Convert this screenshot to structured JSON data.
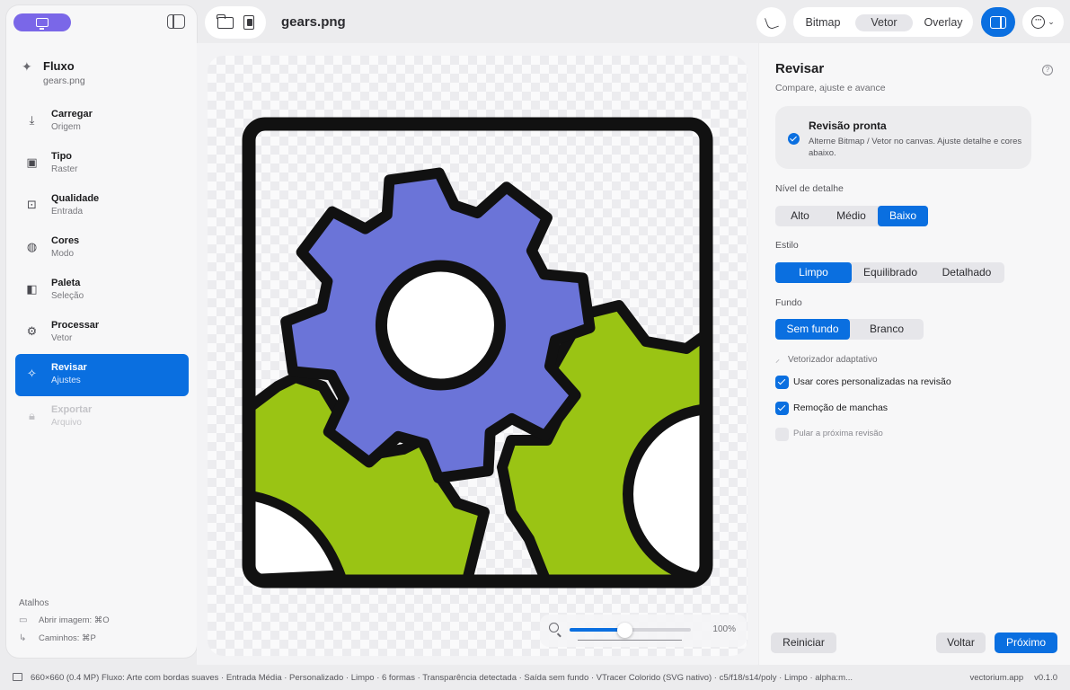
{
  "header": {
    "file_name": "gears.png"
  },
  "view_modes": {
    "options": [
      "Bitmap",
      "Vetor",
      "Overlay"
    ],
    "selected": "Vetor"
  },
  "sidebar": {
    "flow_title": "Fluxo",
    "flow_file": "gears.png",
    "steps": [
      {
        "name": "Carregar",
        "sub": "Origem",
        "icon": "download-icon",
        "state": "done"
      },
      {
        "name": "Tipo",
        "sub": "Raster",
        "icon": "images-icon",
        "state": "done"
      },
      {
        "name": "Qualidade",
        "sub": "Entrada",
        "icon": "quality-icon",
        "state": "done"
      },
      {
        "name": "Cores",
        "sub": "Modo",
        "icon": "palette-icon",
        "state": "done"
      },
      {
        "name": "Paleta",
        "sub": "Seleção",
        "icon": "swatches-icon",
        "state": "done"
      },
      {
        "name": "Processar",
        "sub": "Vetor",
        "icon": "gears-icon",
        "state": "done"
      },
      {
        "name": "Revisar",
        "sub": "Ajustes",
        "icon": "sparkle-icon",
        "state": "active"
      },
      {
        "name": "Exportar",
        "sub": "Arquivo",
        "icon": "lock-icon",
        "state": "disabled"
      }
    ],
    "shortcuts_title": "Atalhos",
    "shortcuts": [
      {
        "label": "Abrir imagem: ⌘O",
        "icon": "image-icon"
      },
      {
        "label": "Caminhos: ⌘P",
        "icon": "path-icon"
      }
    ]
  },
  "canvas": {
    "zoom_label": "100%",
    "zoom_level": 0.45
  },
  "review": {
    "title": "Revisar",
    "subtitle": "Compare, ajuste e avance",
    "ready_title": "Revisão pronta",
    "ready_desc": "Alterne Bitmap / Vetor no canvas. Ajuste detalhe e cores abaixo.",
    "detail_label": "Nível de detalhe",
    "detail_options": [
      "Alto",
      "Médio",
      "Baixo"
    ],
    "detail_selected": "Baixo",
    "style_label": "Estilo",
    "style_options": [
      "Limpo",
      "Equilibrado",
      "Detalhado"
    ],
    "style_selected": "Limpo",
    "bg_label": "Fundo",
    "bg_options": [
      "Sem fundo",
      "Branco"
    ],
    "bg_selected": "Sem fundo",
    "adaptive_label": "Vetorizador adaptativo",
    "checkboxes": [
      {
        "label": "Usar cores personalizadas na revisão",
        "checked": true
      },
      {
        "label": "Remoção de manchas",
        "checked": true
      },
      {
        "label": "Pular a próxima revisão",
        "checked": false
      }
    ],
    "reset_label": "Reiniciar",
    "back_label": "Voltar",
    "next_label": "Próximo"
  },
  "status": {
    "text": "660×660 (0.4 MP)   Fluxo: Arte com bordas suaves · Entrada Média · Personalizado · Limpo · 6 formas · Transparência detectada · Saída sem fundo · VTracer Colorido (SVG nativo) · c5/f18/s14/poly · Limpo · alpha:m...",
    "site": "vectorium.app",
    "version": "v0.1.0"
  },
  "colors": {
    "accent": "#0a6fe0",
    "brand": "#7a67e8",
    "gear_blue": "#6b74d8",
    "gear_green": "#9ac414"
  }
}
